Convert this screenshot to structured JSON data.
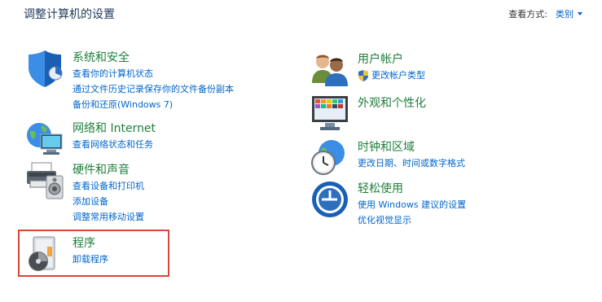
{
  "header": {
    "title": "调整计算机的设置",
    "view_by_label": "查看方式:",
    "view_by_value": "类别"
  },
  "categories": [
    {
      "title": "系统和安全",
      "links": [
        "查看你的计算机状态",
        "通过文件历史记录保存你的文件备份副本",
        "备份和还原(Windows 7)"
      ]
    },
    {
      "title": "网络和 Internet",
      "links": [
        "查看网络状态和任务"
      ]
    },
    {
      "title": "硬件和声音",
      "links": [
        "查看设备和打印机",
        "添加设备",
        "调整常用移动设置"
      ]
    },
    {
      "title": "程序",
      "links": [
        "卸载程序"
      ]
    },
    {
      "title": "用户帐户",
      "links": [
        "更改帐户类型"
      ]
    },
    {
      "title": "外观和个性化",
      "links": []
    },
    {
      "title": "时钟和区域",
      "links": [
        "更改日期、时间或数字格式"
      ]
    },
    {
      "title": "轻松使用",
      "links": [
        "使用 Windows 建议的设置",
        "优化视觉显示"
      ]
    }
  ],
  "colors": {
    "title_green": "#1e7f3a",
    "link_blue": "#0066cc",
    "highlight_red": "#d9443b"
  }
}
